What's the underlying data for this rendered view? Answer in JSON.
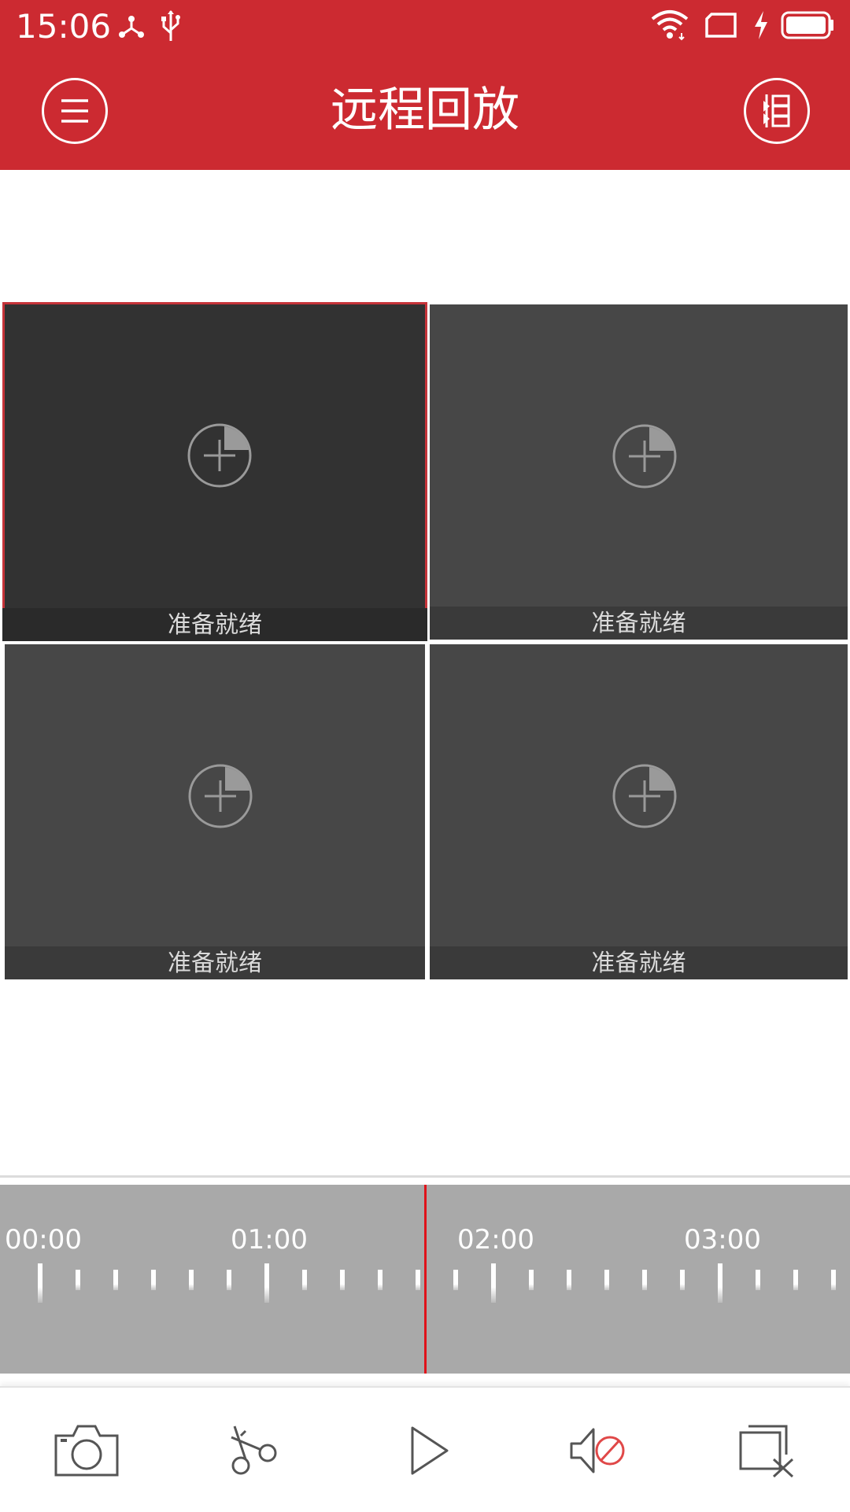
{
  "status_bar": {
    "time": "15:06"
  },
  "header": {
    "title": "远程回放"
  },
  "tiles": [
    {
      "status": "准备就绪",
      "selected": true
    },
    {
      "status": "准备就绪",
      "selected": false
    },
    {
      "status": "准备就绪",
      "selected": false
    },
    {
      "status": "准备就绪",
      "selected": false
    }
  ],
  "timeline": {
    "labels": [
      "00:00",
      "01:00",
      "02:00",
      "03:00"
    ]
  },
  "toolbar": {
    "buttons": [
      "capture-icon",
      "clip-icon",
      "play-icon",
      "mute-icon",
      "close-all-icon"
    ]
  },
  "colors": {
    "header": "#cc2a31",
    "tile": "#474747",
    "tile_selected": "#323232",
    "selection_border": "#c53339",
    "timeline_bg": "#a9a9a9",
    "playhead": "#e0121a"
  }
}
